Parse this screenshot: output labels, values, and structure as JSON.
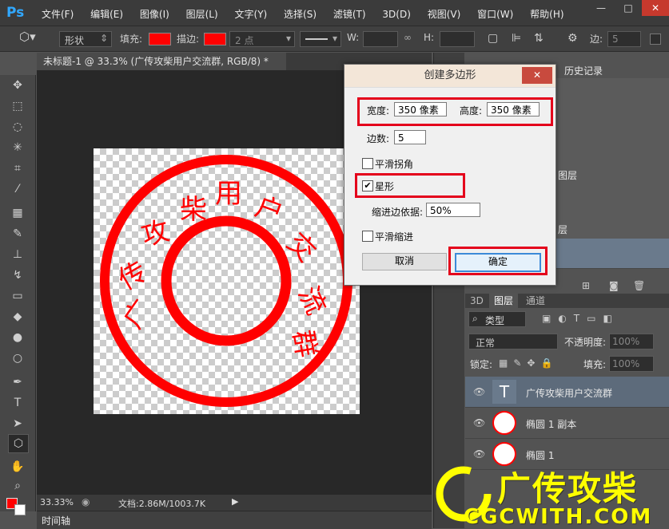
{
  "app": {
    "logo": "Ps",
    "menus": [
      "文件(F)",
      "编辑(E)",
      "图像(I)",
      "图层(L)",
      "文字(Y)",
      "选择(S)",
      "滤镜(T)",
      "3D(D)",
      "视图(V)",
      "窗口(W)",
      "帮助(H)"
    ],
    "window_controls": {
      "minimize": "—",
      "maximize": "□",
      "close": "✕"
    }
  },
  "options_bar": {
    "mode": "形状",
    "fill_label": "填充:",
    "stroke_label": "描边:",
    "stroke_width": "2 点",
    "w_label": "W:",
    "h_label": "H:",
    "sides_label": "边:",
    "sides_value": "5",
    "fill_color": "#ff0000",
    "stroke_color": "#ff0000"
  },
  "document": {
    "tab_title": "未标题-1 @ 33.3% (广传攻柴用户交流群, RGB/8) *",
    "tab_close": "×",
    "zoom": "33.33%",
    "doc_size": "文档:2.86M/1003.7K",
    "timeline_label": "时间轴"
  },
  "dialog": {
    "title": "创建多边形",
    "close": "✕",
    "width_label": "宽度:",
    "width_value": "350 像素",
    "height_label": "高度:",
    "height_value": "350 像素",
    "sides_label": "边数:",
    "sides_value": "5",
    "smooth_corners_label": "平滑拐角",
    "star_label": "星形",
    "indent_label": "缩进边依据:",
    "indent_value": "50%",
    "smooth_indents_label": "平滑缩进",
    "cancel_label": "取消",
    "ok_label": "确定",
    "smooth_corners_checked": false,
    "star_checked": true,
    "smooth_indents_checked": false
  },
  "history_panel": {
    "tab_label": "历史记录",
    "items": [
      "图层",
      "层"
    ]
  },
  "layers_panel": {
    "tabs": [
      "3D",
      "图层",
      "通道"
    ],
    "filter_label": "类型",
    "blend_mode": "正常",
    "opacity_label": "不透明度:",
    "opacity_value": "100%",
    "lock_label": "锁定:",
    "fill_label": "填充:",
    "fill_value": "100%",
    "layers": [
      {
        "name": "广传攻柴用户交流群",
        "thumb": "T"
      },
      {
        "name": "椭圆 1 副本",
        "thumb": "ellipse"
      },
      {
        "name": "椭圆 1",
        "thumb": "ellipse"
      }
    ]
  },
  "watermark": {
    "title": "广传攻柴",
    "domain": "CGCWITH.COM",
    "color": "#ffff00"
  },
  "colors": {
    "highlight": "#e4001b",
    "stamp_red": "#ff0000"
  }
}
